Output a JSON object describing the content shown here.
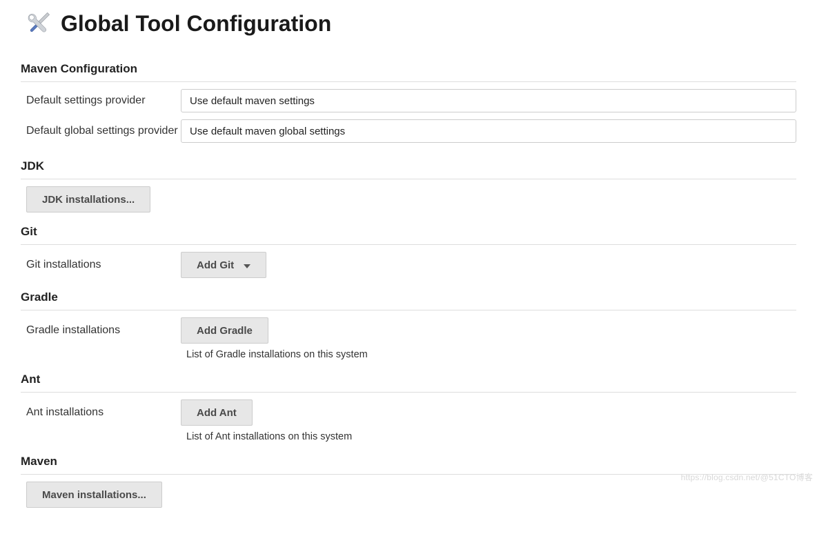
{
  "page_title": "Global Tool Configuration",
  "maven_config": {
    "title": "Maven Configuration",
    "default_settings_label": "Default settings provider",
    "default_settings_value": "Use default maven settings",
    "default_global_label": "Default global settings provider",
    "default_global_value": "Use default maven global settings"
  },
  "jdk": {
    "title": "JDK",
    "installations_button": "JDK installations..."
  },
  "git": {
    "title": "Git",
    "installations_label": "Git installations",
    "add_button": "Add Git"
  },
  "gradle": {
    "title": "Gradle",
    "installations_label": "Gradle installations",
    "add_button": "Add Gradle",
    "desc": "List of Gradle installations on this system"
  },
  "ant": {
    "title": "Ant",
    "installations_label": "Ant installations",
    "add_button": "Add Ant",
    "desc": "List of Ant installations on this system"
  },
  "maven": {
    "title": "Maven",
    "installations_button": "Maven installations..."
  },
  "watermark": "https://blog.csdn.net/@51CTO博客"
}
